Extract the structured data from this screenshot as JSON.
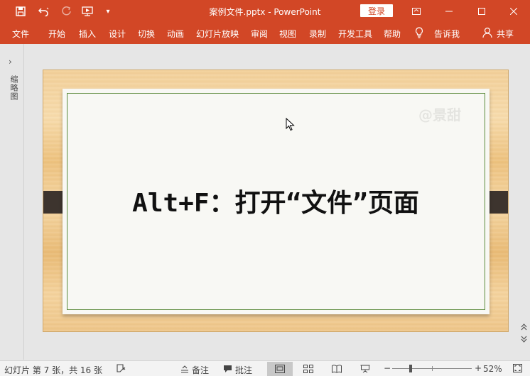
{
  "titlebar": {
    "title": "案例文件.pptx  -  PowerPoint",
    "login_label": "登录",
    "icons": [
      "save-icon",
      "undo-icon",
      "redo-icon",
      "start-from-beginning-icon",
      "customize-quick-access-icon",
      "ribbon-display-options-icon",
      "minimize-icon",
      "maximize-icon",
      "close-icon"
    ]
  },
  "ribbon": {
    "tabs": [
      "文件",
      "开始",
      "插入",
      "设计",
      "切换",
      "动画",
      "幻灯片放映",
      "审阅",
      "视图",
      "录制",
      "开发工具",
      "帮助"
    ],
    "tell_me": "告诉我",
    "share": "共享"
  },
  "leftpanel": {
    "label": "缩略图"
  },
  "slide": {
    "heading": "Alt+F：打开“文件”页面",
    "watermark": "@景甜"
  },
  "statusbar": {
    "slide_info": "幻灯片 第 7 张，共 16 张",
    "notes": "备注",
    "comments": "批注",
    "zoom_minus": "−",
    "zoom_plus": "+",
    "zoom": "52%"
  },
  "colors": {
    "brand": "#d24726",
    "status_bg": "#f3f3f3"
  }
}
